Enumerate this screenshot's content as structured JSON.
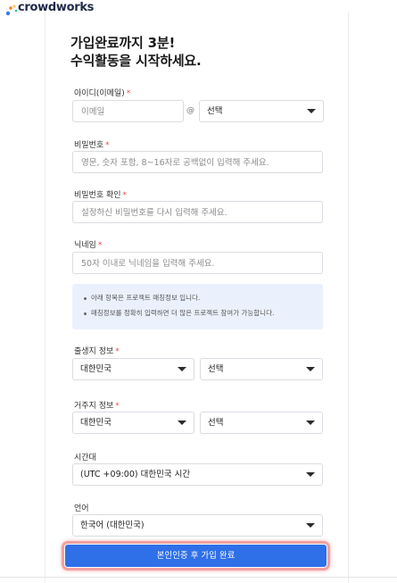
{
  "brand": {
    "name": "crowdworks"
  },
  "headline": {
    "line1": "가입완료까지 3분!",
    "line2": "수익활동을 시작하세요."
  },
  "email": {
    "label": "아이디(이메일)",
    "required_mark": "*",
    "placeholder": "이메일",
    "at_symbol": "@",
    "domain_value": "선택"
  },
  "password": {
    "label": "비밀번호",
    "required_mark": "*",
    "placeholder": "영문, 숫자 포함, 8~16자로 공백없이 입력해 주세요."
  },
  "password_confirm": {
    "label": "비밀번호 확인",
    "required_mark": "*",
    "placeholder": "설정하신 비밀번호를 다시 입력해 주세요."
  },
  "nickname": {
    "label": "닉네임",
    "required_mark": "*",
    "placeholder": "50자 이내로 닉네임을 입력해 주세요."
  },
  "notice": {
    "items": [
      "아래 항목은 프로젝트 매칭정보 입니다.",
      "매칭정보를 정확히 입력하면 더 많은 프로젝트 참여가 가능합니다."
    ]
  },
  "birthplace": {
    "label": "출생지 정보",
    "required_mark": "*",
    "country_value": "대한민국",
    "region_value": "선택"
  },
  "residence": {
    "label": "거주지 정보",
    "required_mark": "*",
    "country_value": "대한민국",
    "region_value": "선택"
  },
  "timezone": {
    "label": "시간대",
    "value": "(UTC +09:00) 대한민국 시간"
  },
  "language": {
    "label": "언어",
    "value": "한국어 (대한민국)"
  },
  "submit": {
    "label": "본인인증 후 가입 완료"
  }
}
